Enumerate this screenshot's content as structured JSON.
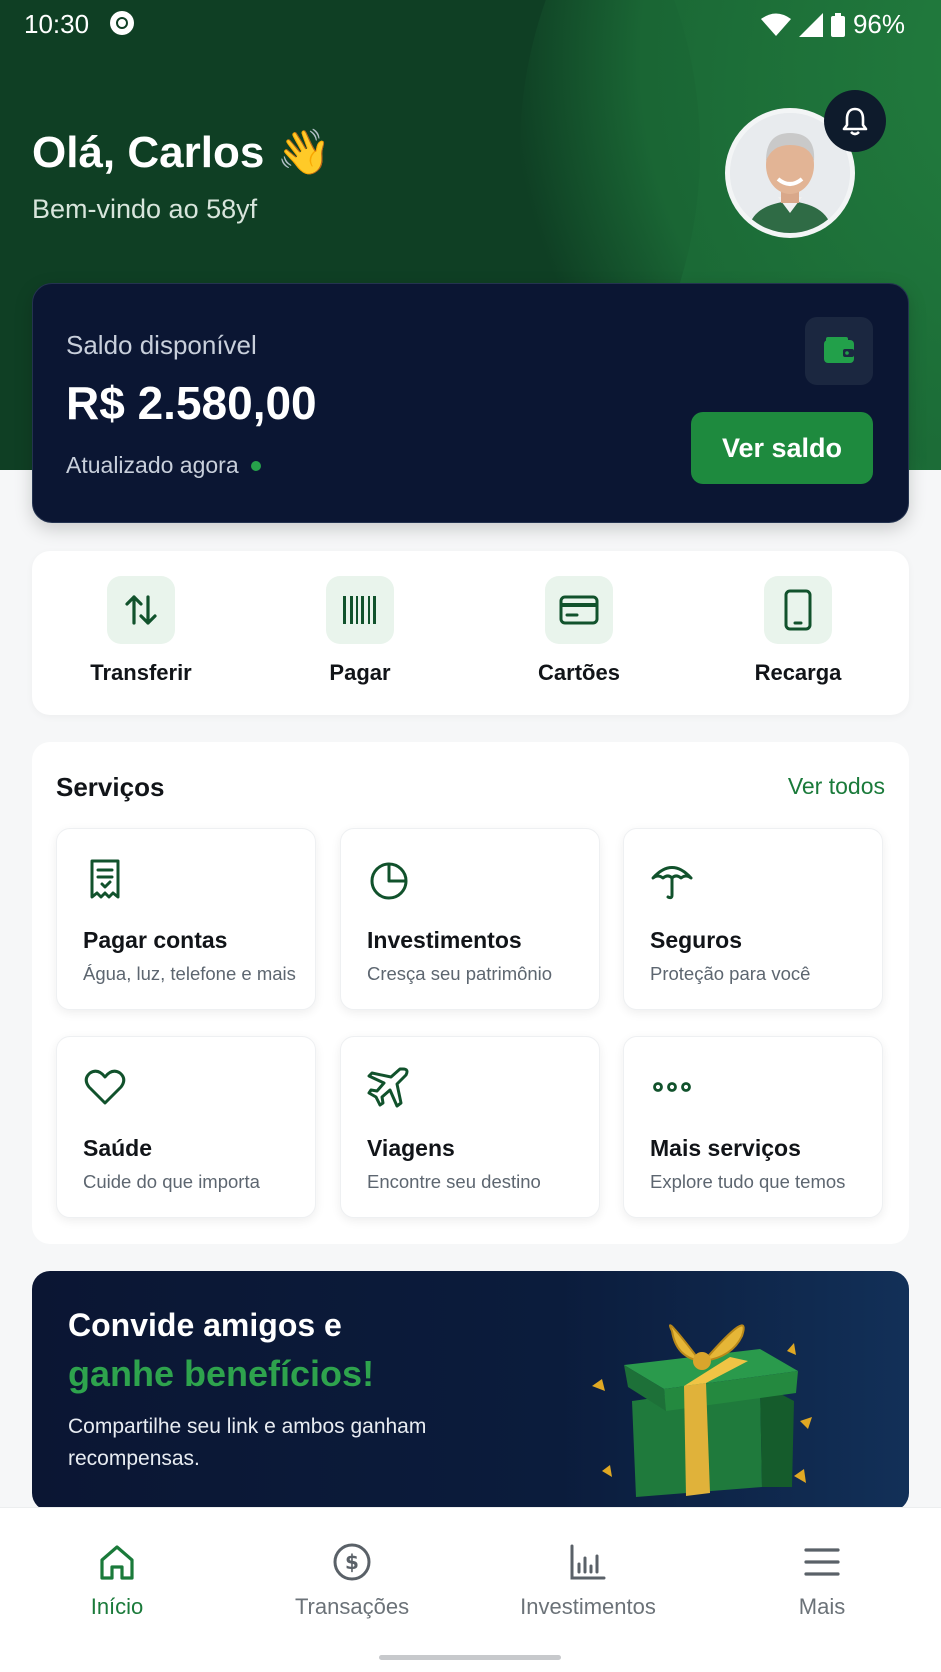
{
  "status_bar": {
    "time": "10:30",
    "battery": "96%"
  },
  "header": {
    "greeting": "Olá, Carlos 👋",
    "subtitle": "Bem-vindo ao 58yf"
  },
  "balance": {
    "label": "Saldo disponível",
    "amount": "R$ 2.580,00",
    "updated": "Atualizado agora",
    "button": "Ver saldo"
  },
  "quick_actions": [
    {
      "label": "Transferir",
      "icon": "transfer-icon"
    },
    {
      "label": "Pagar",
      "icon": "barcode-icon"
    },
    {
      "label": "Cartões",
      "icon": "card-icon"
    },
    {
      "label": "Recarga",
      "icon": "phone-icon"
    }
  ],
  "services": {
    "title": "Serviços",
    "see_all": "Ver todos",
    "items": [
      {
        "title": "Pagar contas",
        "subtitle": "Água, luz, telefone e mais",
        "icon": "receipt-icon"
      },
      {
        "title": "Investimentos",
        "subtitle": "Cresça seu patrimônio",
        "icon": "pie-chart-icon"
      },
      {
        "title": "Seguros",
        "subtitle": "Proteção para você",
        "icon": "umbrella-icon"
      },
      {
        "title": "Saúde",
        "subtitle": "Cuide do que importa",
        "icon": "heart-icon"
      },
      {
        "title": "Viagens",
        "subtitle": "Encontre seu destino",
        "icon": "plane-icon"
      },
      {
        "title": "Mais serviços",
        "subtitle": "Explore tudo que temos",
        "icon": "more-icon"
      }
    ]
  },
  "promo": {
    "line1": "Convide amigos e",
    "line2": "ganhe benefícios!",
    "text": "Compartilhe seu link e ambos ganham recompensas."
  },
  "bottom_nav": [
    {
      "label": "Início",
      "icon": "home-icon",
      "active": true
    },
    {
      "label": "Transações",
      "icon": "dollar-icon",
      "active": false
    },
    {
      "label": "Investimentos",
      "icon": "bar-chart-icon",
      "active": false
    },
    {
      "label": "Mais",
      "icon": "menu-icon",
      "active": false
    }
  ],
  "colors": {
    "brand_green": "#1e8a3e",
    "navy": "#0b1633",
    "header_green": "#11472a"
  }
}
